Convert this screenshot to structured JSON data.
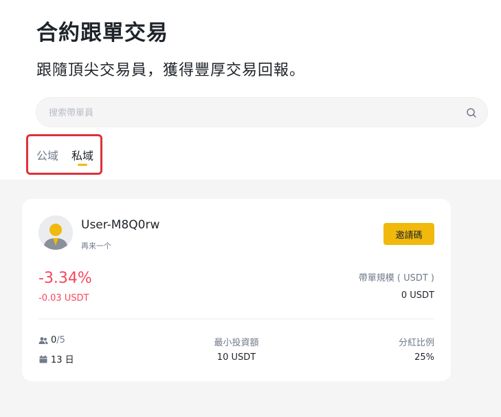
{
  "header": {
    "title": "合約跟單交易",
    "subtitle": "跟隨頂尖交易員，獲得豐厚交易回報。"
  },
  "search": {
    "placeholder": "搜索帶單員",
    "value": ""
  },
  "tabs": [
    {
      "label": "公域",
      "active": false
    },
    {
      "label": "私域",
      "active": true
    }
  ],
  "card": {
    "username": "User-M8Q0rw",
    "note": "再来一个",
    "invite_label": "邀請碼",
    "roi": "-3.34%",
    "pnl": "-0.03 USDT",
    "aum_label": "帶單規模 ( USDT )",
    "aum_value": "0 USDT",
    "copiers_current": "0",
    "copiers_max": "/5",
    "days": "13 日",
    "min_invest_label": "最小投資額",
    "min_invest_value": "10 USDT",
    "profit_share_label": "分紅比例",
    "profit_share_value": "25%"
  },
  "colors": {
    "accent": "#f0b90b",
    "negative": "#f6465d",
    "highlight_border": "#e0303a"
  },
  "icons": {
    "search": "search-icon",
    "copiers": "users-icon",
    "days": "calendar-icon",
    "avatar": "user-avatar-icon"
  }
}
